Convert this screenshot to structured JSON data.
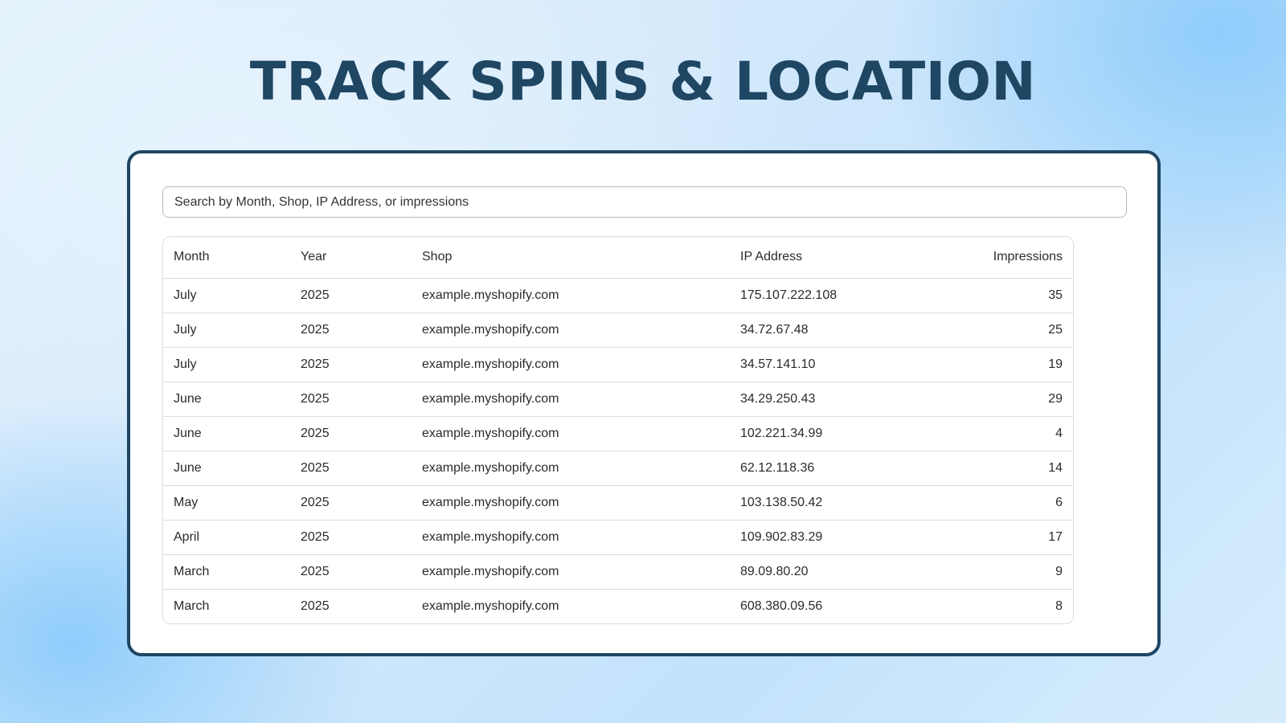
{
  "page": {
    "title": "TRACK SPINS & LOCATION"
  },
  "search": {
    "placeholder": "Search by Month, Shop, IP Address, or impressions"
  },
  "table": {
    "headers": [
      "Month",
      "Year",
      "Shop",
      "IP Address",
      "Impressions"
    ],
    "rows": [
      [
        "July",
        "2025",
        "example.myshopify.com",
        "175.107.222.108",
        "35"
      ],
      [
        "July",
        "2025",
        "example.myshopify.com",
        "34.72.67.48",
        "25"
      ],
      [
        "July",
        "2025",
        "example.myshopify.com",
        "34.57.141.10",
        "19"
      ],
      [
        "June",
        "2025",
        "example.myshopify.com",
        "34.29.250.43",
        "29"
      ],
      [
        "June",
        "2025",
        "example.myshopify.com",
        "102.221.34.99",
        "4"
      ],
      [
        "June",
        "2025",
        "example.myshopify.com",
        "62.12.118.36",
        "14"
      ],
      [
        "May",
        "2025",
        "example.myshopify.com",
        "103.138.50.42",
        "6"
      ],
      [
        "April",
        "2025",
        "example.myshopify.com",
        "109.902.83.29",
        "17"
      ],
      [
        "March",
        "2025",
        "example.myshopify.com",
        "89.09.80.20",
        "9"
      ],
      [
        "March",
        "2025",
        "example.myshopify.com",
        "608.380.09.56",
        "8"
      ]
    ]
  },
  "colors": {
    "title": "#1f4663",
    "card_border": "#1f4663",
    "background": "#cfe7fb"
  }
}
